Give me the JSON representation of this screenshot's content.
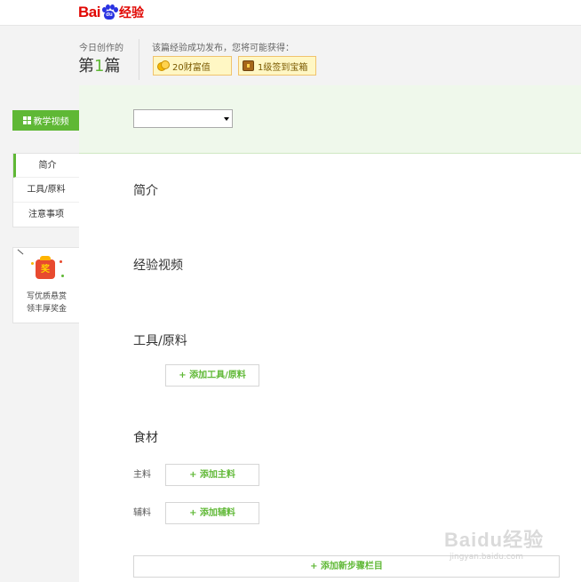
{
  "header": {
    "logo_bai": "Bai",
    "logo_du": "du",
    "logo_jingyan": "经验"
  },
  "today": {
    "label": "今日创作的",
    "prefix": "第",
    "count": "1",
    "suffix": "篇"
  },
  "rewards": {
    "title": "该篇经验成功发布，您将可能获得：",
    "items": [
      {
        "label": "20财富值",
        "icon": "coin-icon"
      },
      {
        "label": "1级签到宝箱",
        "icon": "treasure-chest-icon"
      }
    ]
  },
  "sidebar": {
    "video_button": "教学视频",
    "nav": [
      {
        "label": "简介",
        "active": true
      },
      {
        "label": "工具/原料",
        "active": false
      },
      {
        "label": "注意事项",
        "active": false
      }
    ],
    "promo": {
      "badge": "奖",
      "line1": "写优质悬赏",
      "line2": "领丰厚奖金"
    }
  },
  "main": {
    "category_select_value": "",
    "sections": {
      "intro": "简介",
      "video": "经验视频",
      "tools": "工具/原料",
      "ingredients": "食材"
    },
    "add_tool_button": "+ 添加工具/原料",
    "main_ingredient_label": "主料",
    "add_main_button": "+ 添加主料",
    "side_ingredient_label": "辅料",
    "add_side_button": "+ 添加辅料",
    "add_step_button": "+ 添加新步骤栏目"
  },
  "watermark": {
    "logo": "Baidu经验",
    "url": "jingyan.baidu.com"
  },
  "colors": {
    "brand_red": "#e10602",
    "brand_blue": "#2932e1",
    "accent_green": "#5fb835",
    "band_green": "#eff8eb"
  }
}
